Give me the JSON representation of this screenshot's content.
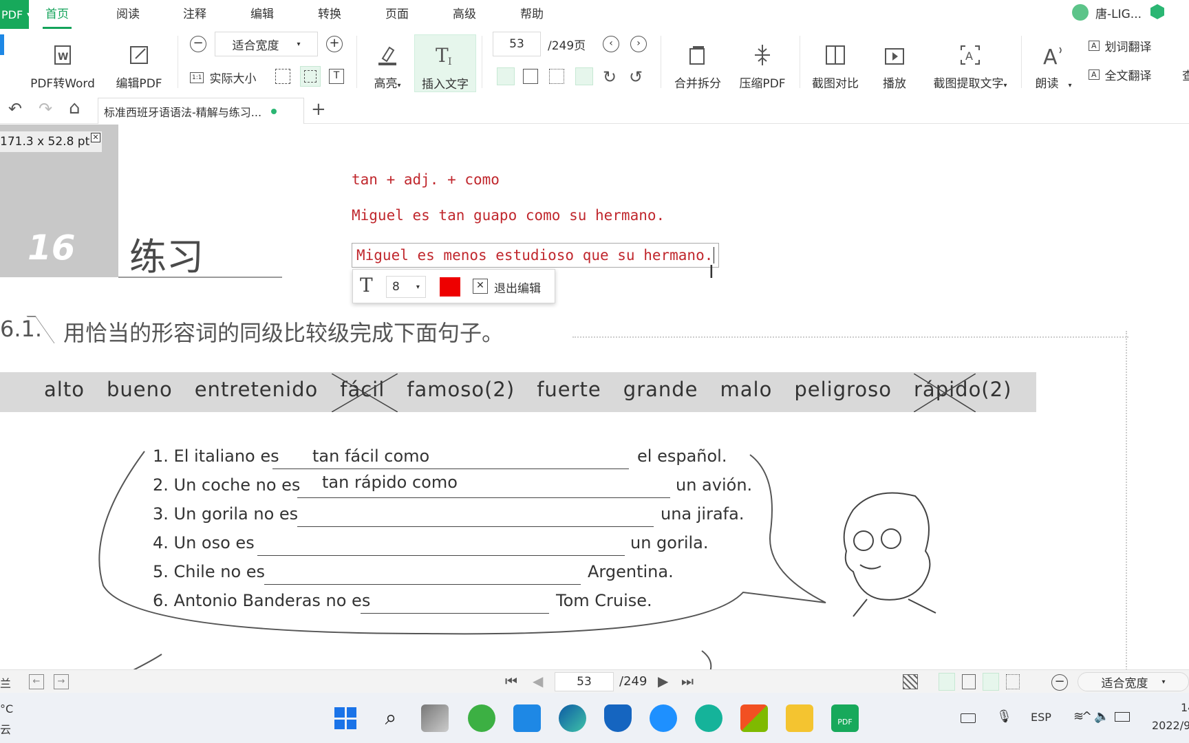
{
  "app": {
    "logo_text": "PDF"
  },
  "menu": [
    "首页",
    "阅读",
    "注释",
    "编辑",
    "转换",
    "页面",
    "高级",
    "帮助"
  ],
  "user": {
    "name": "唐-LIG..."
  },
  "toolbar": {
    "pdf_to_word": "PDF转Word",
    "edit_pdf": "编辑PDF",
    "zoom_mode": "适合宽度",
    "actual_size": "实际大小",
    "highlight": "高亮",
    "insert_text": "插入文字",
    "page_current": "53",
    "page_total": "/249页",
    "merge_split": "合并拆分",
    "compress_pdf": "压缩PDF",
    "screenshot_compare": "截图对比",
    "play": "播放",
    "ocr": "截图提取文字",
    "read_aloud": "朗读",
    "word_translate": "划词翻译",
    "full_translate": "全文翻译",
    "overflow": "查"
  },
  "tab": {
    "title": "标准西班牙语语法-精解与练习..."
  },
  "doc": {
    "selection_size": "171.3 x 52.8 pt",
    "chapter_number": "16",
    "chapter_title": "练习",
    "annot_line1": "tan + adj. + como",
    "annot_line2": "Miguel es tan guapo como su hermano.",
    "annot_edit": "Miguel es menos estudioso que su hermano.",
    "edit_popup": {
      "font_size": "8",
      "exit_label": "退出编辑",
      "color": "#ee0000"
    },
    "exercise_number": "6.1.",
    "exercise_title": "用恰当的形容词的同级比较级完成下面句子。",
    "words": [
      "alto",
      "bueno",
      "entretenido",
      "fácil",
      "famoso(2)",
      "fuerte",
      "grande",
      "malo",
      "peligroso",
      "rápido(2)"
    ],
    "sentences": [
      {
        "pre": "1. El italiano es",
        "answer": "tan fácil como",
        "post": "el español."
      },
      {
        "pre": "2. Un coche no es",
        "answer": "tan rápido como",
        "post": "un avión."
      },
      {
        "pre": "3. Un gorila no es",
        "answer": "",
        "post": "una jirafa."
      },
      {
        "pre": "4. Un oso es",
        "answer": "",
        "post": "un gorila."
      },
      {
        "pre": "5. Chile no es",
        "answer": "",
        "post": "Argentina."
      },
      {
        "pre": "6. Antonio Banderas no es",
        "answer": "",
        "post": "Tom Cruise."
      }
    ]
  },
  "status": {
    "left_label": "兰",
    "page_current": "53",
    "page_total": "/249",
    "zoom": "适合宽度"
  },
  "taskbar": {
    "weather_temp": "°C",
    "weather_desc": "云",
    "lang": "ESP",
    "time": "14",
    "date": "2022/9"
  },
  "colors": {
    "brand_green": "#17a95b",
    "annot_red": "#c0272d"
  }
}
